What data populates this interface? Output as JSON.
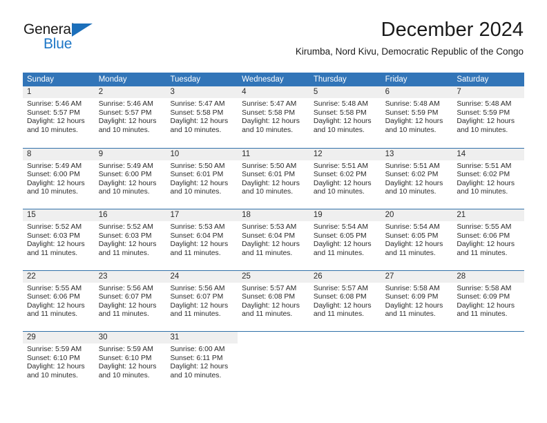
{
  "brand": {
    "name_top": "General",
    "name_bottom": "Blue"
  },
  "header": {
    "title": "December 2024",
    "subtitle": "Kirumba, Nord Kivu, Democratic Republic of the Congo"
  },
  "colors": {
    "header_blue": "#3275b8",
    "rule_blue": "#2f6fa8",
    "daynum_band": "#efefef",
    "brand_blue": "#1c76c6"
  },
  "weekdays": [
    "Sunday",
    "Monday",
    "Tuesday",
    "Wednesday",
    "Thursday",
    "Friday",
    "Saturday"
  ],
  "weeks": [
    [
      {
        "day": "1",
        "sunrise": "Sunrise: 5:46 AM",
        "sunset": "Sunset: 5:57 PM",
        "daylight_1": "Daylight: 12 hours",
        "daylight_2": "and 10 minutes."
      },
      {
        "day": "2",
        "sunrise": "Sunrise: 5:46 AM",
        "sunset": "Sunset: 5:57 PM",
        "daylight_1": "Daylight: 12 hours",
        "daylight_2": "and 10 minutes."
      },
      {
        "day": "3",
        "sunrise": "Sunrise: 5:47 AM",
        "sunset": "Sunset: 5:58 PM",
        "daylight_1": "Daylight: 12 hours",
        "daylight_2": "and 10 minutes."
      },
      {
        "day": "4",
        "sunrise": "Sunrise: 5:47 AM",
        "sunset": "Sunset: 5:58 PM",
        "daylight_1": "Daylight: 12 hours",
        "daylight_2": "and 10 minutes."
      },
      {
        "day": "5",
        "sunrise": "Sunrise: 5:48 AM",
        "sunset": "Sunset: 5:58 PM",
        "daylight_1": "Daylight: 12 hours",
        "daylight_2": "and 10 minutes."
      },
      {
        "day": "6",
        "sunrise": "Sunrise: 5:48 AM",
        "sunset": "Sunset: 5:59 PM",
        "daylight_1": "Daylight: 12 hours",
        "daylight_2": "and 10 minutes."
      },
      {
        "day": "7",
        "sunrise": "Sunrise: 5:48 AM",
        "sunset": "Sunset: 5:59 PM",
        "daylight_1": "Daylight: 12 hours",
        "daylight_2": "and 10 minutes."
      }
    ],
    [
      {
        "day": "8",
        "sunrise": "Sunrise: 5:49 AM",
        "sunset": "Sunset: 6:00 PM",
        "daylight_1": "Daylight: 12 hours",
        "daylight_2": "and 10 minutes."
      },
      {
        "day": "9",
        "sunrise": "Sunrise: 5:49 AM",
        "sunset": "Sunset: 6:00 PM",
        "daylight_1": "Daylight: 12 hours",
        "daylight_2": "and 10 minutes."
      },
      {
        "day": "10",
        "sunrise": "Sunrise: 5:50 AM",
        "sunset": "Sunset: 6:01 PM",
        "daylight_1": "Daylight: 12 hours",
        "daylight_2": "and 10 minutes."
      },
      {
        "day": "11",
        "sunrise": "Sunrise: 5:50 AM",
        "sunset": "Sunset: 6:01 PM",
        "daylight_1": "Daylight: 12 hours",
        "daylight_2": "and 10 minutes."
      },
      {
        "day": "12",
        "sunrise": "Sunrise: 5:51 AM",
        "sunset": "Sunset: 6:02 PM",
        "daylight_1": "Daylight: 12 hours",
        "daylight_2": "and 10 minutes."
      },
      {
        "day": "13",
        "sunrise": "Sunrise: 5:51 AM",
        "sunset": "Sunset: 6:02 PM",
        "daylight_1": "Daylight: 12 hours",
        "daylight_2": "and 10 minutes."
      },
      {
        "day": "14",
        "sunrise": "Sunrise: 5:51 AM",
        "sunset": "Sunset: 6:02 PM",
        "daylight_1": "Daylight: 12 hours",
        "daylight_2": "and 10 minutes."
      }
    ],
    [
      {
        "day": "15",
        "sunrise": "Sunrise: 5:52 AM",
        "sunset": "Sunset: 6:03 PM",
        "daylight_1": "Daylight: 12 hours",
        "daylight_2": "and 11 minutes."
      },
      {
        "day": "16",
        "sunrise": "Sunrise: 5:52 AM",
        "sunset": "Sunset: 6:03 PM",
        "daylight_1": "Daylight: 12 hours",
        "daylight_2": "and 11 minutes."
      },
      {
        "day": "17",
        "sunrise": "Sunrise: 5:53 AM",
        "sunset": "Sunset: 6:04 PM",
        "daylight_1": "Daylight: 12 hours",
        "daylight_2": "and 11 minutes."
      },
      {
        "day": "18",
        "sunrise": "Sunrise: 5:53 AM",
        "sunset": "Sunset: 6:04 PM",
        "daylight_1": "Daylight: 12 hours",
        "daylight_2": "and 11 minutes."
      },
      {
        "day": "19",
        "sunrise": "Sunrise: 5:54 AM",
        "sunset": "Sunset: 6:05 PM",
        "daylight_1": "Daylight: 12 hours",
        "daylight_2": "and 11 minutes."
      },
      {
        "day": "20",
        "sunrise": "Sunrise: 5:54 AM",
        "sunset": "Sunset: 6:05 PM",
        "daylight_1": "Daylight: 12 hours",
        "daylight_2": "and 11 minutes."
      },
      {
        "day": "21",
        "sunrise": "Sunrise: 5:55 AM",
        "sunset": "Sunset: 6:06 PM",
        "daylight_1": "Daylight: 12 hours",
        "daylight_2": "and 11 minutes."
      }
    ],
    [
      {
        "day": "22",
        "sunrise": "Sunrise: 5:55 AM",
        "sunset": "Sunset: 6:06 PM",
        "daylight_1": "Daylight: 12 hours",
        "daylight_2": "and 11 minutes."
      },
      {
        "day": "23",
        "sunrise": "Sunrise: 5:56 AM",
        "sunset": "Sunset: 6:07 PM",
        "daylight_1": "Daylight: 12 hours",
        "daylight_2": "and 11 minutes."
      },
      {
        "day": "24",
        "sunrise": "Sunrise: 5:56 AM",
        "sunset": "Sunset: 6:07 PM",
        "daylight_1": "Daylight: 12 hours",
        "daylight_2": "and 11 minutes."
      },
      {
        "day": "25",
        "sunrise": "Sunrise: 5:57 AM",
        "sunset": "Sunset: 6:08 PM",
        "daylight_1": "Daylight: 12 hours",
        "daylight_2": "and 11 minutes."
      },
      {
        "day": "26",
        "sunrise": "Sunrise: 5:57 AM",
        "sunset": "Sunset: 6:08 PM",
        "daylight_1": "Daylight: 12 hours",
        "daylight_2": "and 11 minutes."
      },
      {
        "day": "27",
        "sunrise": "Sunrise: 5:58 AM",
        "sunset": "Sunset: 6:09 PM",
        "daylight_1": "Daylight: 12 hours",
        "daylight_2": "and 11 minutes."
      },
      {
        "day": "28",
        "sunrise": "Sunrise: 5:58 AM",
        "sunset": "Sunset: 6:09 PM",
        "daylight_1": "Daylight: 12 hours",
        "daylight_2": "and 11 minutes."
      }
    ],
    [
      {
        "day": "29",
        "sunrise": "Sunrise: 5:59 AM",
        "sunset": "Sunset: 6:10 PM",
        "daylight_1": "Daylight: 12 hours",
        "daylight_2": "and 10 minutes."
      },
      {
        "day": "30",
        "sunrise": "Sunrise: 5:59 AM",
        "sunset": "Sunset: 6:10 PM",
        "daylight_1": "Daylight: 12 hours",
        "daylight_2": "and 10 minutes."
      },
      {
        "day": "31",
        "sunrise": "Sunrise: 6:00 AM",
        "sunset": "Sunset: 6:11 PM",
        "daylight_1": "Daylight: 12 hours",
        "daylight_2": "and 10 minutes."
      },
      {
        "day": "",
        "sunrise": "",
        "sunset": "",
        "daylight_1": "",
        "daylight_2": ""
      },
      {
        "day": "",
        "sunrise": "",
        "sunset": "",
        "daylight_1": "",
        "daylight_2": ""
      },
      {
        "day": "",
        "sunrise": "",
        "sunset": "",
        "daylight_1": "",
        "daylight_2": ""
      },
      {
        "day": "",
        "sunrise": "",
        "sunset": "",
        "daylight_1": "",
        "daylight_2": ""
      }
    ]
  ]
}
